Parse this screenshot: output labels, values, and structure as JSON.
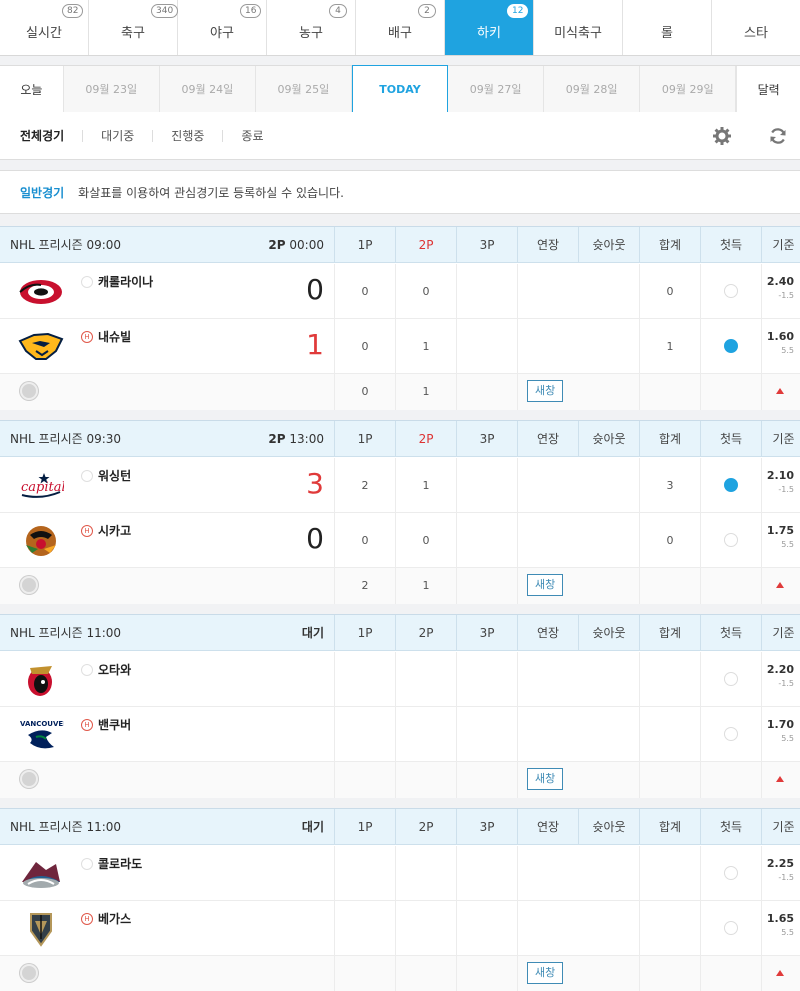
{
  "sport_tabs": [
    {
      "label": "실시간",
      "badge": "82"
    },
    {
      "label": "축구",
      "badge": "340"
    },
    {
      "label": "야구",
      "badge": "16"
    },
    {
      "label": "농구",
      "badge": "4"
    },
    {
      "label": "배구",
      "badge": "2"
    },
    {
      "label": "하키",
      "badge": "12"
    },
    {
      "label": "미식축구",
      "badge": ""
    },
    {
      "label": "롤",
      "badge": ""
    },
    {
      "label": "스타",
      "badge": ""
    }
  ],
  "dates": {
    "today_label": "오늘",
    "items": [
      "09월 23일",
      "09월 24일",
      "09월 25일",
      "TODAY",
      "09월 27일",
      "09월 28일",
      "09월 29일"
    ],
    "calendar_label": "달력"
  },
  "filters": [
    "전체경기",
    "대기중",
    "진행중",
    "종료"
  ],
  "notice": {
    "tag": "일반경기",
    "message": "화살표를 이용하여 관심경기로 등록하실 수 있습니다."
  },
  "columns": [
    "1P",
    "2P",
    "3P",
    "연장",
    "슛아웃",
    "합계",
    "첫득",
    "기준"
  ],
  "games": [
    {
      "league": "NHL 프리시즌  09:00",
      "status_period": "2P",
      "status_time": "00:00",
      "live_col": "2P",
      "teams": [
        {
          "name": "캐롤라이나",
          "home": "",
          "score": "0",
          "p1": "0",
          "p2": "0",
          "total": "0",
          "first": false,
          "odds": "2.40",
          "line": "-1.5",
          "logo": "hurricanes-logo"
        },
        {
          "name": "내슈빌",
          "home": "H",
          "score": "1",
          "p1": "0",
          "p2": "1",
          "total": "1",
          "first": true,
          "odds": "1.60",
          "line": "5.5",
          "logo": "predators-logo"
        }
      ],
      "sum_row": {
        "p1": "0",
        "p2": "1"
      },
      "new_window": "새창"
    },
    {
      "league": "NHL 프리시즌  09:30",
      "status_period": "2P",
      "status_time": "13:00",
      "live_col": "2P",
      "teams": [
        {
          "name": "워싱턴",
          "home": "",
          "score": "3",
          "p1": "2",
          "p2": "1",
          "total": "3",
          "first": true,
          "odds": "2.10",
          "line": "-1.5",
          "logo": "capitals-logo"
        },
        {
          "name": "시카고",
          "home": "H",
          "score": "0",
          "p1": "0",
          "p2": "0",
          "total": "0",
          "first": false,
          "odds": "1.75",
          "line": "5.5",
          "logo": "blackhawks-logo"
        }
      ],
      "sum_row": {
        "p1": "2",
        "p2": "1"
      },
      "new_window": "새창"
    },
    {
      "league": "NHL 프리시즌  11:00",
      "status_period": "대기",
      "status_time": "",
      "live_col": "",
      "teams": [
        {
          "name": "오타와",
          "home": "",
          "score": "",
          "p1": "",
          "p2": "",
          "total": "",
          "first": false,
          "odds": "2.20",
          "line": "-1.5",
          "logo": "senators-logo"
        },
        {
          "name": "밴쿠버",
          "home": "H",
          "score": "",
          "p1": "",
          "p2": "",
          "total": "",
          "first": false,
          "odds": "1.70",
          "line": "5.5",
          "logo": "canucks-logo"
        }
      ],
      "sum_row": {
        "p1": "",
        "p2": ""
      },
      "new_window": "새창"
    },
    {
      "league": "NHL 프리시즌  11:00",
      "status_period": "대기",
      "status_time": "",
      "live_col": "",
      "teams": [
        {
          "name": "콜로라도",
          "home": "",
          "score": "",
          "p1": "",
          "p2": "",
          "total": "",
          "first": false,
          "odds": "2.25",
          "line": "-1.5",
          "logo": "avalanche-logo"
        },
        {
          "name": "베가스",
          "home": "H",
          "score": "",
          "p1": "",
          "p2": "",
          "total": "",
          "first": false,
          "odds": "1.65",
          "line": "5.5",
          "logo": "golden-knights-logo"
        }
      ],
      "sum_row": {
        "p1": "",
        "p2": ""
      },
      "new_window": "새창"
    }
  ],
  "colors": {
    "accent": "#1fa3e0",
    "win": "#e03a3a",
    "header_bg": "#e7f4fb"
  }
}
